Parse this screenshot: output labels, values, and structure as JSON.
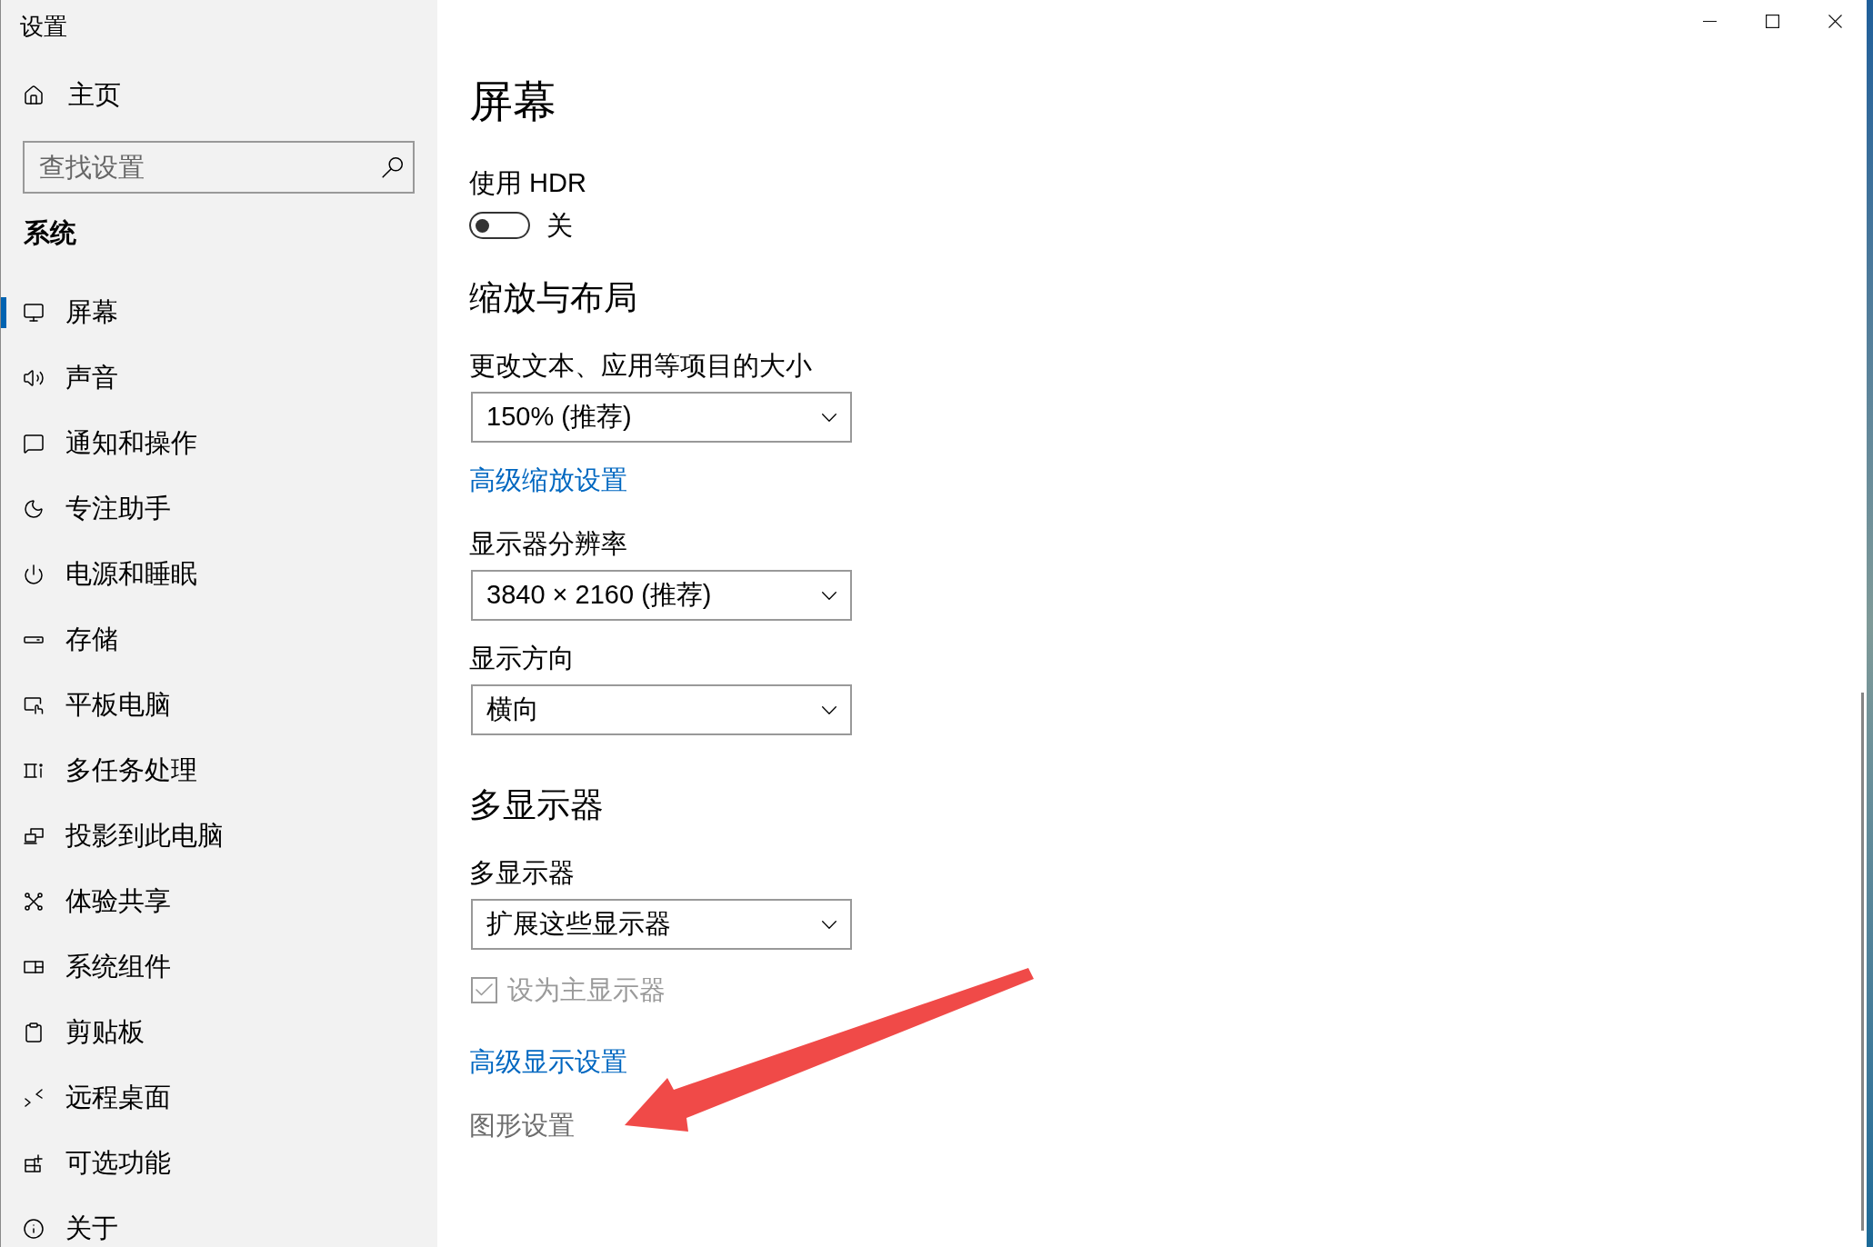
{
  "window": {
    "title": "设置"
  },
  "sidebar": {
    "home": {
      "label": "主页"
    },
    "search": {
      "placeholder": "查找设置"
    },
    "section_title": "系统",
    "items": [
      {
        "label": "屏幕",
        "selected": true
      },
      {
        "label": "声音",
        "selected": false
      },
      {
        "label": "通知和操作",
        "selected": false
      },
      {
        "label": "专注助手",
        "selected": false
      },
      {
        "label": "电源和睡眠",
        "selected": false
      },
      {
        "label": "存储",
        "selected": false
      },
      {
        "label": "平板电脑",
        "selected": false
      },
      {
        "label": "多任务处理",
        "selected": false
      },
      {
        "label": "投影到此电脑",
        "selected": false
      },
      {
        "label": "体验共享",
        "selected": false
      },
      {
        "label": "系统组件",
        "selected": false
      },
      {
        "label": "剪贴板",
        "selected": false
      },
      {
        "label": "远程桌面",
        "selected": false
      },
      {
        "label": "可选功能",
        "selected": false
      },
      {
        "label": "关于",
        "selected": false
      }
    ]
  },
  "content": {
    "title": "屏幕",
    "blocks": [
      {
        "kind": "label",
        "text": "使用 HDR"
      },
      {
        "kind": "toggle",
        "on": false,
        "text": "关"
      },
      {
        "kind": "heading",
        "text": "缩放与布局"
      },
      {
        "kind": "label",
        "text": "更改文本、应用等项目的大小"
      },
      {
        "kind": "dropdown",
        "value": "150% (推荐)"
      },
      {
        "kind": "link",
        "text": "高级缩放设置",
        "hovered": false
      },
      {
        "kind": "label",
        "text": "显示器分辨率"
      },
      {
        "kind": "dropdown",
        "value": "3840 × 2160 (推荐)"
      },
      {
        "kind": "label",
        "text": "显示方向"
      },
      {
        "kind": "dropdown",
        "value": "横向"
      },
      {
        "kind": "heading",
        "text": "多显示器"
      },
      {
        "kind": "label",
        "text": "多显示器"
      },
      {
        "kind": "dropdown",
        "value": "扩展这些显示器"
      },
      {
        "kind": "checkbox",
        "text": "设为主显示器",
        "checked": true,
        "disabled": true
      },
      {
        "kind": "link",
        "text": "高级显示设置",
        "hovered": false
      },
      {
        "kind": "link",
        "text": "图形设置",
        "hovered": true
      }
    ]
  }
}
